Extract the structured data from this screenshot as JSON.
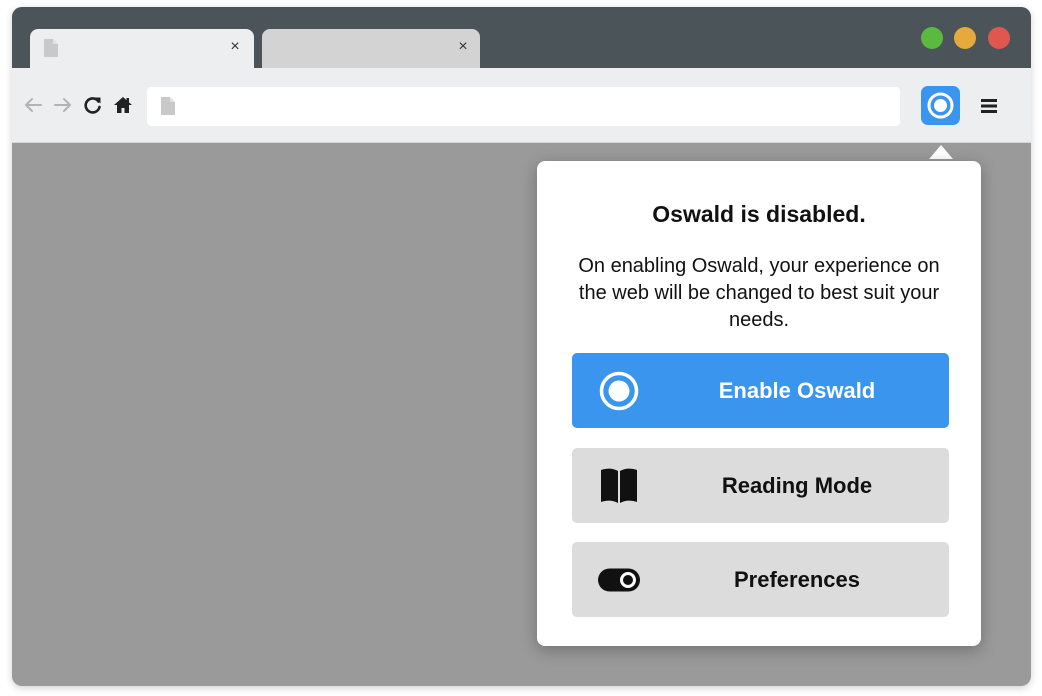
{
  "colors": {
    "titlebar": "#4a5459",
    "toolbar": "#eceef0",
    "content_bg": "#9a9a9a",
    "accent": "#3a95ee",
    "traffic_green": "#5cb93f",
    "traffic_yellow": "#e6a93b",
    "traffic_red": "#e0574f"
  },
  "tabs": [
    {
      "icon": "document-icon",
      "title": "",
      "close_label": "×",
      "active": true
    },
    {
      "icon": "",
      "title": "",
      "close_label": "×",
      "active": false
    }
  ],
  "window_controls": [
    "traffic-light-green",
    "traffic-light-yellow",
    "traffic-light-red"
  ],
  "toolbar": {
    "back_icon": "arrow-left-icon",
    "forward_icon": "arrow-right-icon",
    "reload_icon": "reload-icon",
    "home_icon": "home-icon",
    "address": {
      "value": "",
      "placeholder": "",
      "icon": "document-icon"
    },
    "extension_icon": "oswald-icon",
    "menu_icon": "hamburger-menu-icon"
  },
  "popup": {
    "title": "Oswald is disabled.",
    "description": "On enabling Oswald, your experience on the web will be changed to best suit your needs.",
    "actions": [
      {
        "label": "Enable Oswald",
        "icon": "oswald-ring-icon"
      },
      {
        "label": "Reading Mode",
        "icon": "book-icon"
      },
      {
        "label": "Preferences",
        "icon": "toggle-icon"
      }
    ]
  }
}
